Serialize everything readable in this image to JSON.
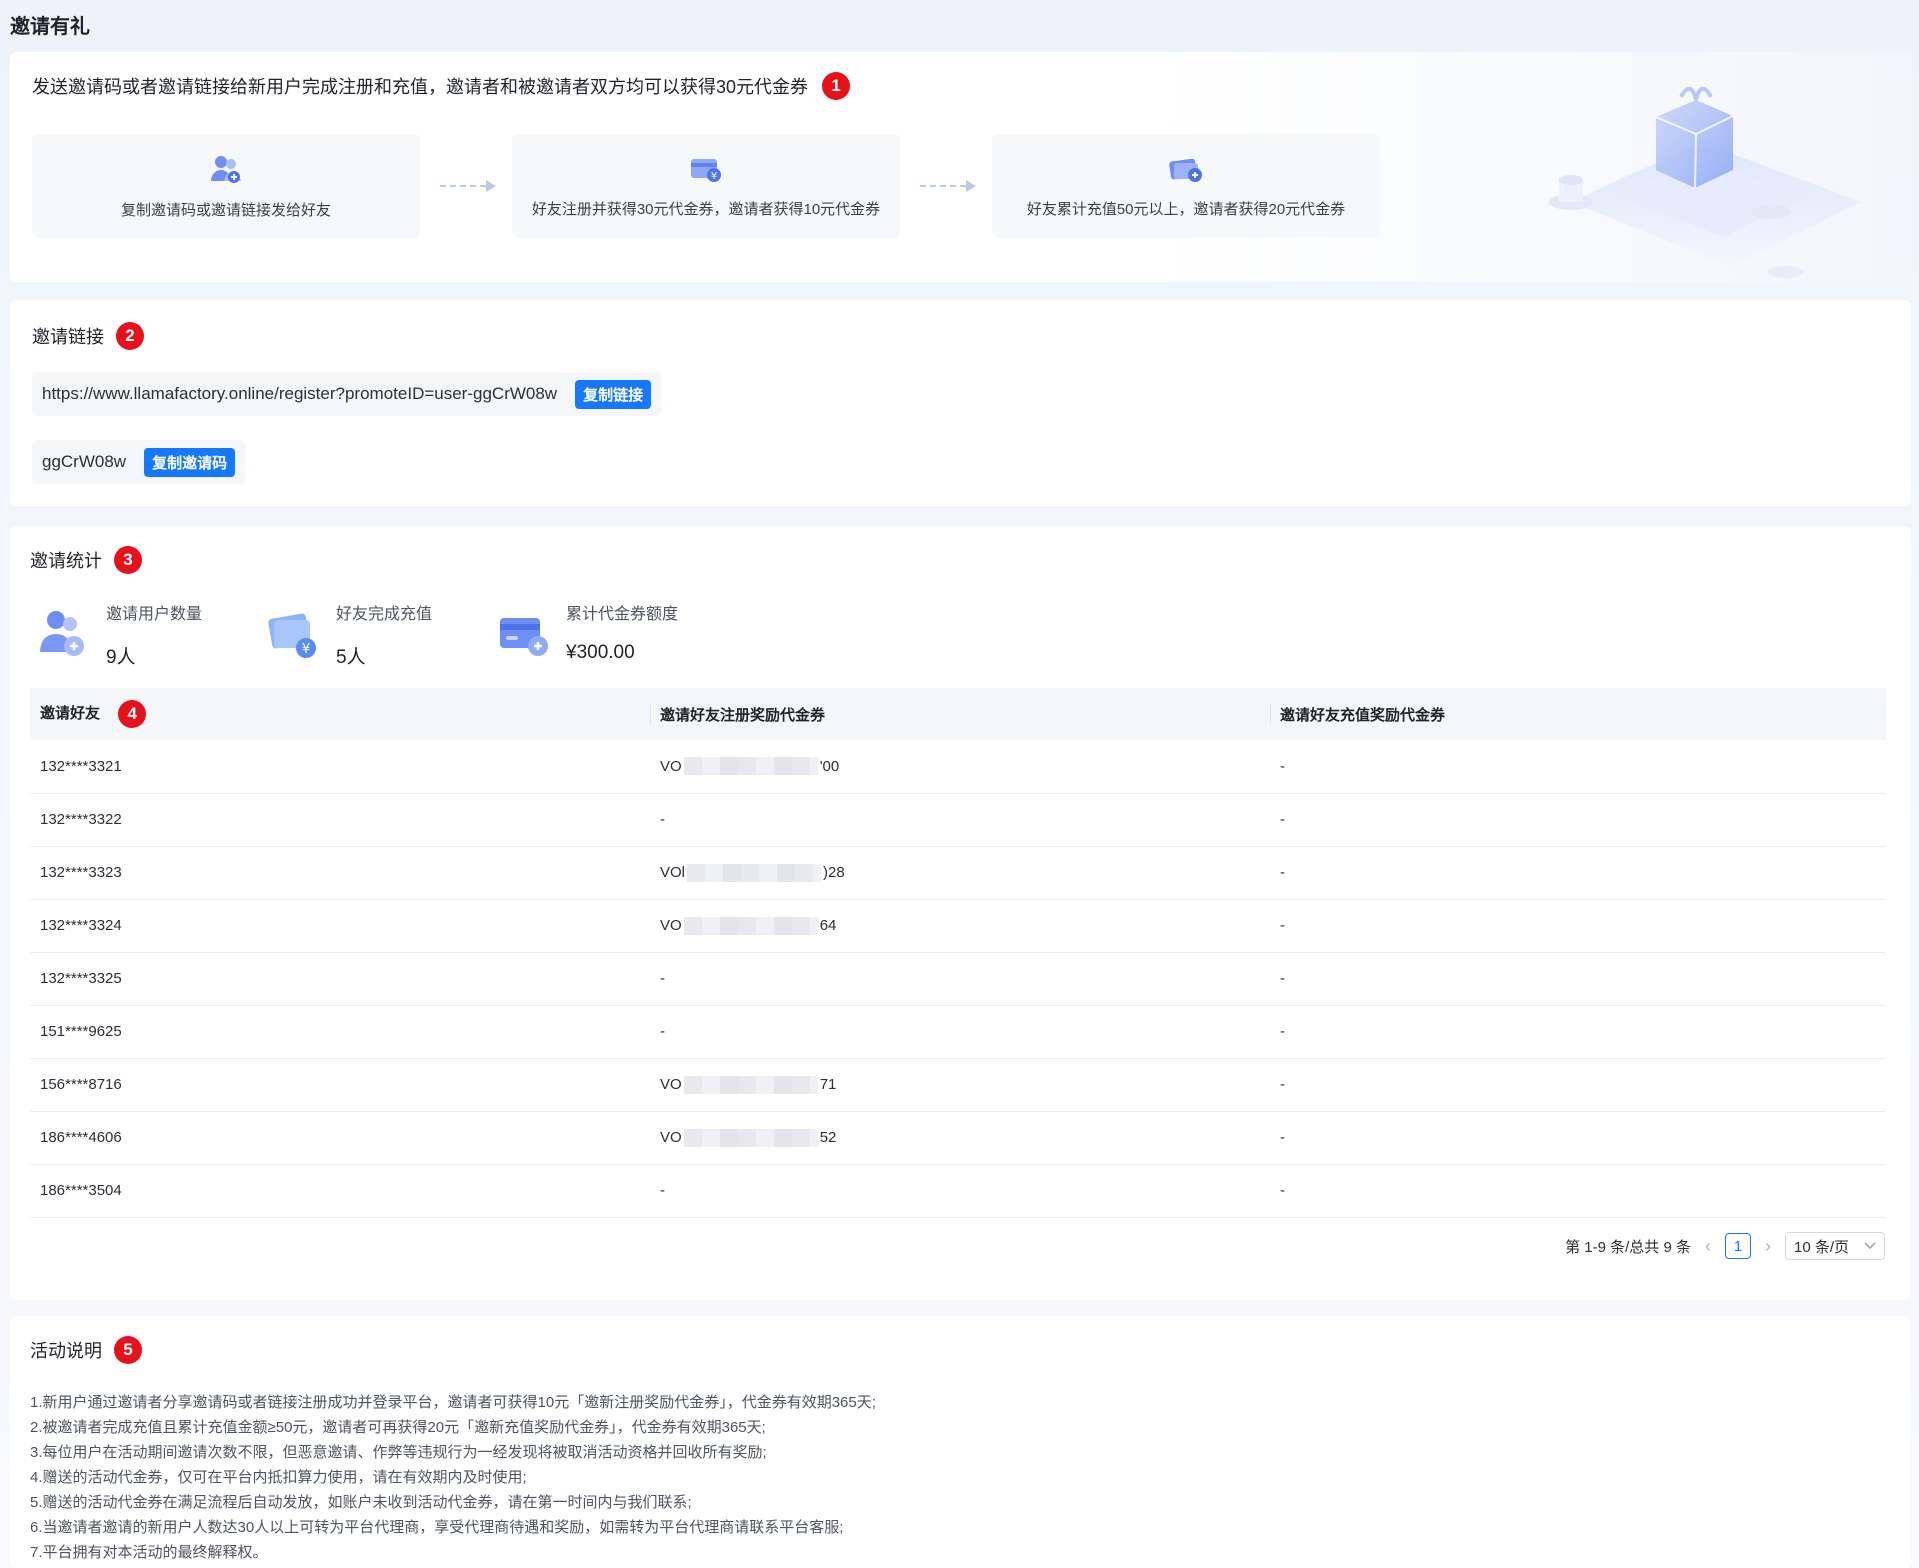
{
  "page": {
    "title": "邀请有礼"
  },
  "intro": {
    "text": "发送邀请码或者邀请链接给新用户完成注册和充值，邀请者和被邀请者双方均可以获得30元代金券",
    "badge": "1",
    "steps": [
      {
        "label": "复制邀请码或邀请链接发给好友",
        "icon": "users-icon"
      },
      {
        "label": "好友注册并获得30元代金券，邀请者获得10元代金券",
        "icon": "register-card-icon"
      },
      {
        "label": "好友累计充值50元以上，邀请者获得20元代金券",
        "icon": "recharge-card-icon"
      }
    ]
  },
  "invite_link": {
    "title": "邀请链接",
    "badge": "2",
    "url": "https://www.llamafactory.online/register?promoteID=user-ggCrW08w",
    "copy_link_label": "复制链接",
    "code": "ggCrW08w",
    "copy_code_label": "复制邀请码"
  },
  "stats": {
    "title": "邀请统计",
    "badge": "3",
    "items": [
      {
        "label": "邀请用户数量",
        "value": "9人"
      },
      {
        "label": "好友完成充值",
        "value": "5人"
      },
      {
        "label": "累计代金券额度",
        "value": "¥300.00"
      }
    ]
  },
  "table": {
    "badge": "4",
    "headers": [
      "邀请好友",
      "邀请好友注册奖励代金券",
      "邀请好友充值奖励代金券"
    ],
    "rows": [
      {
        "friend": "132****3321",
        "reg_prefix": "VO",
        "reg_suffix": "'00",
        "recharge": "-"
      },
      {
        "friend": "132****3322",
        "reg": "-",
        "recharge": "-"
      },
      {
        "friend": "132****3323",
        "reg_prefix": "VOl",
        "reg_suffix": ")28",
        "recharge": "-"
      },
      {
        "friend": "132****3324",
        "reg_prefix": "VO",
        "reg_suffix": "64",
        "recharge": "-"
      },
      {
        "friend": "132****3325",
        "reg": "-",
        "recharge": "-"
      },
      {
        "friend": "151****9625",
        "reg": "-",
        "recharge": "-"
      },
      {
        "friend": "156****8716",
        "reg_prefix": "VO",
        "reg_suffix": "71",
        "recharge": "-"
      },
      {
        "friend": "186****4606",
        "reg_prefix": "VO",
        "reg_suffix": "52",
        "recharge": "-"
      },
      {
        "friend": "186****3504",
        "reg": "-",
        "recharge": "-"
      }
    ]
  },
  "pagination": {
    "summary": "第 1-9 条/总共 9 条",
    "current_page": "1",
    "page_size": "10 条/页"
  },
  "rules": {
    "title": "活动说明",
    "badge": "5",
    "items": [
      "1.新用户通过邀请者分享邀请码或者链接注册成功并登录平台，邀请者可获得10元「邀新注册奖励代金券」，代金券有效期365天;",
      "2.被邀请者完成充值且累计充值金额≥50元，邀请者可再获得20元「邀新充值奖励代金券」，代金券有效期365天;",
      "3.每位用户在活动期间邀请次数不限，但恶意邀请、作弊等违规行为一经发现将被取消活动资格并回收所有奖励;",
      "4.赠送的活动代金券，仅可在平台内抵扣算力使用，请在有效期内及时使用;",
      "5.赠送的活动代金券在满足流程后自动发放，如账户未收到活动代金券，请在第一时间内与我们联系;",
      "6.当邀请者邀请的新用户人数达30人以上可转为平台代理商，享受代理商待遇和奖励，如需转为平台代理商请联系平台客服;",
      "7.平台拥有对本活动的最终解释权。"
    ]
  },
  "colors": {
    "accent": "#1677ff",
    "badge": "#e8101b"
  }
}
